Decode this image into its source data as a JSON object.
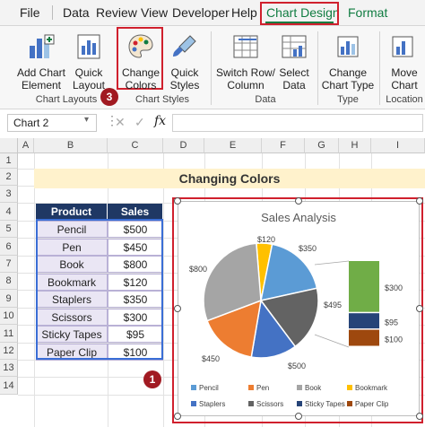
{
  "menubar": {
    "items": [
      "File",
      "Data",
      "Review",
      "View",
      "Developer",
      "Help",
      "Chart Design",
      "Format"
    ]
  },
  "ribbon": {
    "add_chart_element": "Add Chart\nElement",
    "quick_layout": "Quick\nLayout",
    "change_colors": "Change\nColors",
    "quick_styles": "Quick\nStyles",
    "switch_row_column": "Switch Row/\nColumn",
    "select_data": "Select\nData",
    "change_chart_type": "Change\nChart Type",
    "move_chart": "Move\nChart",
    "groups": {
      "chart_layouts": "Chart Layouts",
      "chart_styles": "Chart Styles",
      "data": "Data",
      "type": "Type",
      "location": "Location"
    }
  },
  "callouts": {
    "c1": "1",
    "c2": "2",
    "c3": "3"
  },
  "formula_bar": {
    "name_box": "Chart 2",
    "fx": "fx"
  },
  "grid": {
    "columns": [
      "A",
      "B",
      "C",
      "D",
      "E",
      "F",
      "G",
      "H",
      "I"
    ],
    "rows": [
      "1",
      "2",
      "3",
      "4",
      "5",
      "6",
      "7",
      "8",
      "9",
      "10",
      "11",
      "12",
      "13",
      "14"
    ]
  },
  "sheet": {
    "title": "Changing Colors",
    "table": {
      "headers": [
        "Product",
        "Sales"
      ],
      "rows": [
        [
          "Pencil",
          "$500"
        ],
        [
          "Pen",
          "$450"
        ],
        [
          "Book",
          "$800"
        ],
        [
          "Bookmark",
          "$120"
        ],
        [
          "Staplers",
          "$350"
        ],
        [
          "Scissors",
          "$300"
        ],
        [
          "Sticky Tapes",
          "$95"
        ],
        [
          "Paper Clip",
          "$100"
        ]
      ]
    }
  },
  "chart_data": {
    "type": "pie",
    "title": "Sales Analysis",
    "subtype": "pie-of-bar",
    "categories": [
      "Pencil",
      "Pen",
      "Book",
      "Bookmark",
      "Staplers",
      "Scissors",
      "Sticky Tapes",
      "Paper Clip"
    ],
    "values": [
      500,
      450,
      800,
      120,
      350,
      300,
      95,
      100
    ],
    "data_labels": [
      "$500",
      "$450",
      "$800",
      "$120",
      "$350",
      "$495",
      "$300",
      "$95",
      "$100"
    ],
    "secondary_bar": [
      {
        "label": "$300",
        "value": 300,
        "color": "#70ad47"
      },
      {
        "label": "$95",
        "value": 95,
        "color": "#264478"
      },
      {
        "label": "$100",
        "value": 100,
        "color": "#9e480e"
      }
    ],
    "colors": [
      "#5b9bd5",
      "#ed7d31",
      "#a5a5a5",
      "#ffc000",
      "#4472c4",
      "#636363",
      "#264478",
      "#9e480e"
    ],
    "legend_position": "bottom",
    "pie_label_rows": [
      [
        "Pencil",
        "Pen",
        "Book",
        "Bookmark"
      ],
      [
        "Staplers",
        "Scissors",
        "Sticky Tapes",
        "Paper Clip"
      ]
    ]
  }
}
